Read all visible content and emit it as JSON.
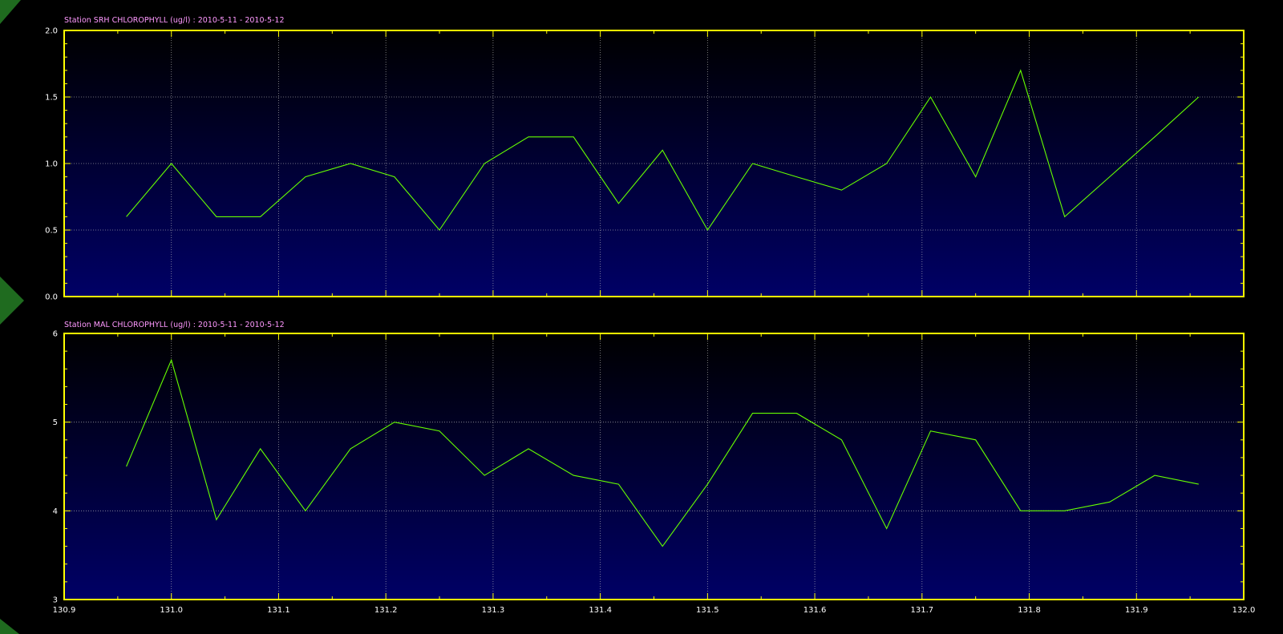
{
  "chart_data": [
    {
      "type": "line",
      "title": "Station SRH CHLOROPHYLL (ug/l) : 2010-5-11  -  2010-5-12",
      "xlabel": "",
      "ylabel": "",
      "xlim": [
        130.9,
        132.0
      ],
      "ylim": [
        0.0,
        2.0
      ],
      "x_ticks": [
        131.0,
        131.1,
        131.2,
        131.3,
        131.4,
        131.5,
        131.6,
        131.7,
        131.8,
        131.9
      ],
      "x_tick_labels": [],
      "y_ticks": [
        0.0,
        0.5,
        1.0,
        1.5,
        2.0
      ],
      "y_tick_labels": [
        "0.0",
        "0.5",
        "1.0",
        "1.5",
        "2.0"
      ],
      "grid": true,
      "colors": {
        "line": "#66ff00",
        "frame": "#ffff00",
        "grid": "#c8c8c8",
        "title": "#ff99ff",
        "bg_top": "#000000",
        "bg_bottom": "#000066"
      },
      "x": [
        130.958,
        131.0,
        131.042,
        131.083,
        131.125,
        131.167,
        131.208,
        131.25,
        131.292,
        131.333,
        131.375,
        131.417,
        131.458,
        131.5,
        131.542,
        131.583,
        131.625,
        131.667,
        131.708,
        131.75,
        131.792,
        131.833,
        131.875,
        131.917,
        131.958
      ],
      "series": [
        {
          "values": [
            0.6,
            1.0,
            0.6,
            0.6,
            0.9,
            1.0,
            0.9,
            0.5,
            1.0,
            1.2,
            1.2,
            0.7,
            1.1,
            0.5,
            1.0,
            0.9,
            0.8,
            1.0,
            1.5,
            0.9,
            1.7,
            0.6,
            0.9,
            1.2,
            1.5
          ]
        }
      ]
    },
    {
      "type": "line",
      "title": "Station MAL CHLOROPHYLL (ug/l) : 2010-5-11  -  2010-5-12",
      "xlabel": "",
      "ylabel": "",
      "xlim": [
        130.9,
        132.0
      ],
      "ylim": [
        3,
        6
      ],
      "x_ticks": [
        130.9,
        131.0,
        131.1,
        131.2,
        131.3,
        131.4,
        131.5,
        131.6,
        131.7,
        131.8,
        131.9,
        132.0
      ],
      "x_tick_labels": [
        "130.9",
        "131.0",
        "131.1",
        "131.2",
        "131.3",
        "131.4",
        "131.5",
        "131.6",
        "131.7",
        "131.8",
        "131.9",
        "132.0"
      ],
      "y_ticks": [
        3,
        4,
        5,
        6
      ],
      "y_tick_labels": [
        "3",
        "4",
        "5",
        "6"
      ],
      "grid": true,
      "colors": {
        "line": "#66ff00",
        "frame": "#ffff00",
        "grid": "#c8c8c8",
        "title": "#ff99ff",
        "bg_top": "#000000",
        "bg_bottom": "#000066"
      },
      "x": [
        130.958,
        131.0,
        131.042,
        131.083,
        131.125,
        131.167,
        131.208,
        131.25,
        131.292,
        131.333,
        131.375,
        131.417,
        131.458,
        131.5,
        131.542,
        131.583,
        131.625,
        131.667,
        131.708,
        131.75,
        131.792,
        131.833,
        131.875,
        131.917,
        131.958
      ],
      "series": [
        {
          "values": [
            4.5,
            5.7,
            3.9,
            4.7,
            4.0,
            4.7,
            5.0,
            4.9,
            4.4,
            4.7,
            4.4,
            4.3,
            3.6,
            4.3,
            5.1,
            5.1,
            4.8,
            3.8,
            4.9,
            4.8,
            4.0,
            4.0,
            4.1,
            4.4,
            4.3
          ]
        }
      ]
    }
  ],
  "decor": {
    "markers": [
      {
        "name": "green-triangle-marker-top"
      },
      {
        "name": "green-triangle-marker-middle"
      },
      {
        "name": "green-triangle-marker-bottom"
      }
    ],
    "marker_color": "#1f6b1f"
  }
}
